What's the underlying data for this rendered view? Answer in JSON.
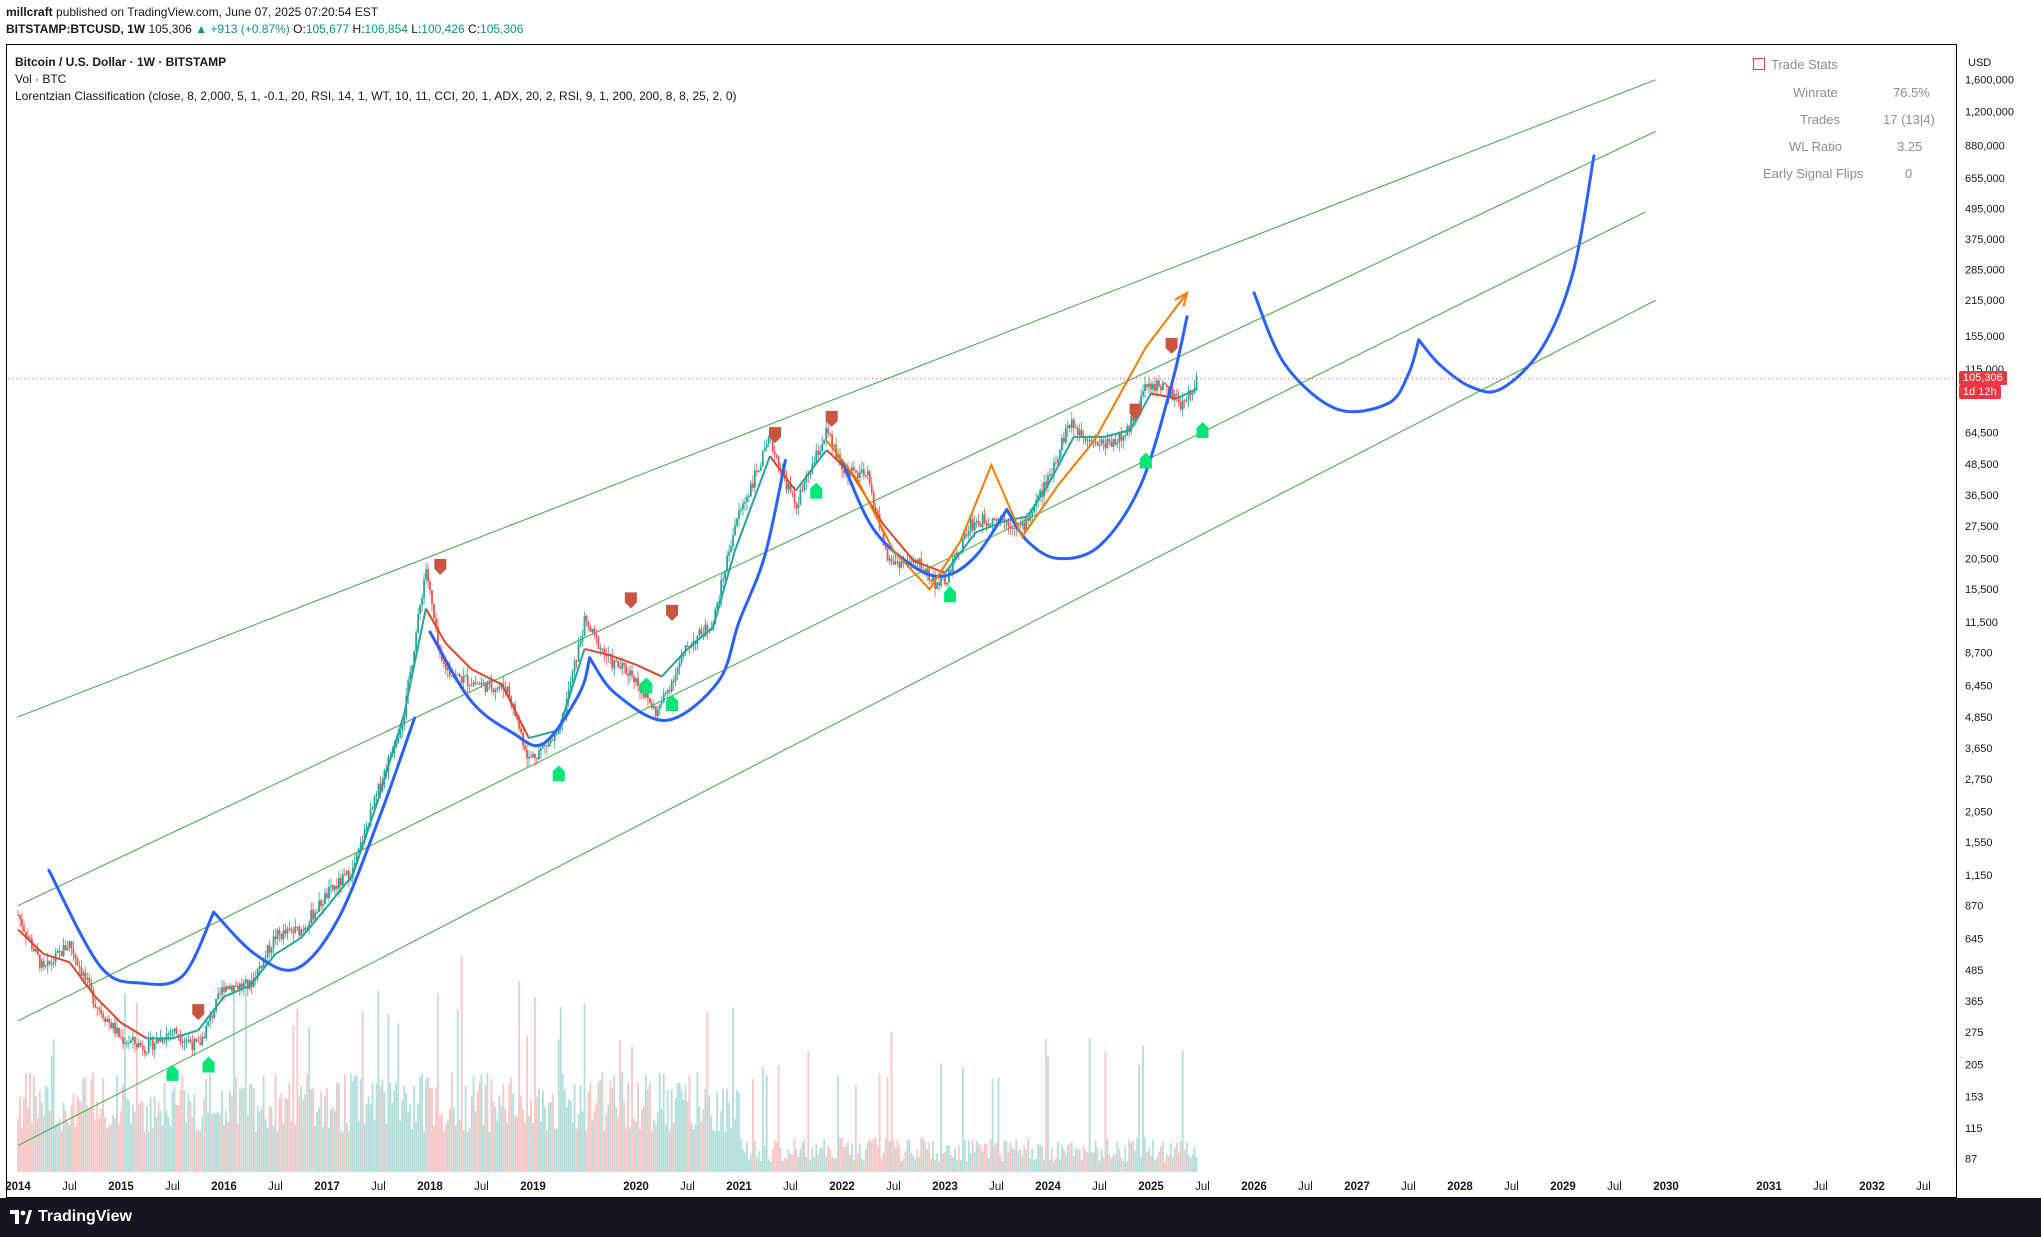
{
  "header": {
    "author": "millcraft",
    "published": "published on TradingView.com, June 07, 2025 07:20:54 EST",
    "symbol": "BITSTAMP:BTCUSD, 1W",
    "last": "105,306",
    "change": "▲ +913 (+0.87%)",
    "o_label": "O:",
    "o_val": "105,677",
    "h_label": "H:",
    "h_val": "106,854",
    "l_label": "L:",
    "l_val": "100,426",
    "c_label": "C:",
    "c_val": "105,306"
  },
  "legend": {
    "title": "Bitcoin / U.S. Dollar · 1W · BITSTAMP",
    "vol": "Vol · BTC",
    "indicator": "Lorentzian Classification (close, 8, 2,000, 5, 1, -0.1, 20, RSI, 14, 1, WT, 10, 11, CCI, 20, 1, ADX, 20, 2, RSI, 9, 1, 200, 200, 8, 8, 25, 2, 0)"
  },
  "trade_stats": {
    "header": "Trade Stats",
    "rows": [
      {
        "label": "Winrate",
        "value": "76.5%"
      },
      {
        "label": "Trades",
        "value": "17 (13|4)"
      },
      {
        "label": "WL Ratio",
        "value": "3.25"
      },
      {
        "label": "Early Signal Flips",
        "value": "0"
      }
    ]
  },
  "price_tag": {
    "price": "105,306",
    "countdown": "1d 12h"
  },
  "footer": {
    "brand": "TradingView"
  },
  "colors": {
    "channel": "#4caf50",
    "projection": "#2962ff",
    "arrow": "#f57c00",
    "kernel_up": "#26a69a",
    "kernel_down": "#d84a2e",
    "buy": "#00e676",
    "sell": "#c8553d",
    "candle_up": "#26a69a",
    "candle_down": "#ef5350",
    "last_price": "#f23645"
  },
  "chart_data": {
    "type": "line",
    "title": "Bitcoin / U.S. Dollar · 1W · BITSTAMP",
    "scale": "log",
    "currency": "USD",
    "y_ticks": [
      "1,600,000",
      "1,200,000",
      "880,000",
      "655,000",
      "495,000",
      "375,000",
      "285,000",
      "215,000",
      "155,000",
      "115,000",
      "64,500",
      "48,500",
      "36,500",
      "27,500",
      "20,500",
      "15,500",
      "11,500",
      "8,700",
      "6,450",
      "4,850",
      "3,650",
      "2,750",
      "2,050",
      "1,550",
      "1,150",
      "870",
      "645",
      "485",
      "365",
      "275",
      "205",
      "153",
      "115",
      "87"
    ],
    "y_tick_values": [
      1600000,
      1200000,
      880000,
      655000,
      495000,
      375000,
      285000,
      215000,
      155000,
      115000,
      64500,
      48500,
      36500,
      27500,
      20500,
      15500,
      11500,
      8700,
      6450,
      4850,
      3650,
      2750,
      2050,
      1550,
      1150,
      870,
      645,
      485,
      365,
      275,
      205,
      153,
      115,
      87
    ],
    "x_ticks": [
      "2014",
      "Jul",
      "2015",
      "Jul",
      "2016",
      "Jul",
      "2017",
      "Jul",
      "2018",
      "Jul",
      "2019",
      "2020",
      "Jul",
      "2021",
      "Jul",
      "2022",
      "Jul",
      "2023",
      "Jul",
      "2024",
      "Jul",
      "2025",
      "Jul",
      "2026",
      "Jul",
      "2027",
      "Jul",
      "2028",
      "Jul",
      "2029",
      "Jul",
      "2030",
      "2031",
      "Jul",
      "2032",
      "Jul"
    ],
    "x_tick_values": [
      2014.0,
      2014.5,
      2015.0,
      2015.5,
      2016.0,
      2016.5,
      2017.0,
      2017.5,
      2018.0,
      2018.5,
      2019.0,
      2020.0,
      2020.5,
      2021.0,
      2021.5,
      2022.0,
      2022.5,
      2023.0,
      2023.5,
      2024.0,
      2024.5,
      2025.0,
      2025.5,
      2026.0,
      2026.5,
      2027.0,
      2027.5,
      2028.0,
      2028.5,
      2029.0,
      2029.5,
      2030.0,
      2031.0,
      2031.5,
      2032.0,
      2032.5
    ],
    "series": [
      {
        "name": "BTCUSD",
        "values": [
          [
            2014.0,
            800
          ],
          [
            2014.25,
            480
          ],
          [
            2014.5,
            620
          ],
          [
            2014.75,
            360
          ],
          [
            2015.0,
            260
          ],
          [
            2015.25,
            240
          ],
          [
            2015.5,
            280
          ],
          [
            2015.75,
            240
          ],
          [
            2016.0,
            420
          ],
          [
            2016.25,
            420
          ],
          [
            2016.5,
            660
          ],
          [
            2016.75,
            700
          ],
          [
            2017.0,
            960
          ],
          [
            2017.25,
            1200
          ],
          [
            2017.5,
            2500
          ],
          [
            2017.75,
            5000
          ],
          [
            2017.96,
            19000
          ],
          [
            2018.1,
            8000
          ],
          [
            2018.25,
            7000
          ],
          [
            2018.5,
            6500
          ],
          [
            2018.75,
            6300
          ],
          [
            2018.96,
            3300
          ],
          [
            2019.25,
            4100
          ],
          [
            2019.5,
            11500
          ],
          [
            2019.75,
            8000
          ],
          [
            2019.96,
            7200
          ],
          [
            2020.2,
            5000
          ],
          [
            2020.5,
            9200
          ],
          [
            2020.75,
            11500
          ],
          [
            2020.96,
            28000
          ],
          [
            2021.3,
            60000
          ],
          [
            2021.55,
            33000
          ],
          [
            2021.85,
            65000
          ],
          [
            2022.0,
            46000
          ],
          [
            2022.25,
            43000
          ],
          [
            2022.45,
            20000
          ],
          [
            2022.75,
            19500
          ],
          [
            2022.9,
            16500
          ],
          [
            2023.0,
            16500
          ],
          [
            2023.25,
            28000
          ],
          [
            2023.5,
            30000
          ],
          [
            2023.75,
            27000
          ],
          [
            2024.0,
            42000
          ],
          [
            2024.2,
            70000
          ],
          [
            2024.5,
            58000
          ],
          [
            2024.75,
            62000
          ],
          [
            2024.95,
            98000
          ],
          [
            2025.1,
            100000
          ],
          [
            2025.3,
            82000
          ],
          [
            2025.45,
            105306
          ]
        ]
      },
      {
        "name": "Kernel estimate",
        "values": [
          [
            2014.0,
            700
          ],
          [
            2014.25,
            560
          ],
          [
            2014.5,
            520
          ],
          [
            2014.75,
            380
          ],
          [
            2015.0,
            300
          ],
          [
            2015.25,
            260
          ],
          [
            2015.5,
            260
          ],
          [
            2015.75,
            280
          ],
          [
            2016.0,
            380
          ],
          [
            2016.25,
            420
          ],
          [
            2016.5,
            560
          ],
          [
            2016.75,
            650
          ],
          [
            2017.0,
            860
          ],
          [
            2017.25,
            1150
          ],
          [
            2017.5,
            2300
          ],
          [
            2017.75,
            5000
          ],
          [
            2017.96,
            13000
          ],
          [
            2018.15,
            9500
          ],
          [
            2018.4,
            7500
          ],
          [
            2018.7,
            6500
          ],
          [
            2018.96,
            4000
          ],
          [
            2019.25,
            4300
          ],
          [
            2019.5,
            9000
          ],
          [
            2019.75,
            8500
          ],
          [
            2020.0,
            7800
          ],
          [
            2020.25,
            7000
          ],
          [
            2020.5,
            9000
          ],
          [
            2020.75,
            11000
          ],
          [
            2020.96,
            22000
          ],
          [
            2021.3,
            52000
          ],
          [
            2021.55,
            38000
          ],
          [
            2021.85,
            55000
          ],
          [
            2022.1,
            44000
          ],
          [
            2022.4,
            28000
          ],
          [
            2022.7,
            20000
          ],
          [
            2023.0,
            18000
          ],
          [
            2023.3,
            26000
          ],
          [
            2023.6,
            29000
          ],
          [
            2023.8,
            30000
          ],
          [
            2024.0,
            40000
          ],
          [
            2024.25,
            62000
          ],
          [
            2024.55,
            62000
          ],
          [
            2024.8,
            66000
          ],
          [
            2025.0,
            92000
          ],
          [
            2025.25,
            88000
          ],
          [
            2025.45,
            96000
          ]
        ]
      }
    ],
    "channel_lines": [
      {
        "from": [
          2014.0,
          4850
        ],
        "to": [
          2029.9,
          1600000
        ]
      },
      {
        "from": [
          2014.0,
          870
        ],
        "to": [
          2029.9,
          1000000
        ]
      },
      {
        "from": [
          2014.0,
          305
        ],
        "to": [
          2029.8,
          480000
        ]
      },
      {
        "from": [
          2014.0,
          98
        ],
        "to": [
          2029.9,
          215000
        ]
      }
    ],
    "projection_curves": [
      [
        [
          2014.3,
          1200
        ],
        [
          2014.8,
          500
        ],
        [
          2015.2,
          430
        ],
        [
          2015.6,
          460
        ],
        [
          2015.9,
          820
        ]
      ],
      [
        [
          2015.9,
          820
        ],
        [
          2016.3,
          560
        ],
        [
          2016.7,
          490
        ],
        [
          2017.1,
          760
        ],
        [
          2017.5,
          1900
        ],
        [
          2017.85,
          4800
        ]
      ],
      [
        [
          2018.0,
          10500
        ],
        [
          2018.4,
          5600
        ],
        [
          2018.8,
          4200
        ],
        [
          2019.1,
          3800
        ],
        [
          2019.45,
          6000
        ],
        [
          2019.55,
          8300
        ]
      ],
      [
        [
          2019.55,
          8300
        ],
        [
          2019.8,
          6000
        ],
        [
          2020.3,
          4700
        ],
        [
          2020.8,
          6700
        ],
        [
          2021.0,
          11500
        ],
        [
          2021.25,
          21000
        ],
        [
          2021.45,
          50000
        ]
      ],
      [
        [
          2022.0,
          50000
        ],
        [
          2022.3,
          27000
        ],
        [
          2022.7,
          19000
        ],
        [
          2023.0,
          17500
        ],
        [
          2023.3,
          21000
        ],
        [
          2023.6,
          32000
        ]
      ],
      [
        [
          2023.6,
          32000
        ],
        [
          2023.8,
          24000
        ],
        [
          2024.1,
          20500
        ],
        [
          2024.5,
          23000
        ],
        [
          2024.9,
          40000
        ],
        [
          2025.2,
          100000
        ],
        [
          2025.35,
          185000
        ]
      ],
      [
        [
          2026.0,
          230000
        ],
        [
          2026.3,
          120000
        ],
        [
          2026.8,
          80000
        ],
        [
          2027.3,
          84000
        ],
        [
          2027.5,
          110000
        ],
        [
          2027.6,
          150000
        ]
      ],
      [
        [
          2027.6,
          150000
        ],
        [
          2027.8,
          120000
        ],
        [
          2028.1,
          98000
        ],
        [
          2028.4,
          96000
        ],
        [
          2028.8,
          140000
        ],
        [
          2029.1,
          280000
        ],
        [
          2029.3,
          800000
        ]
      ]
    ],
    "arrows": [
      [
        [
          2021.85,
          60000
        ],
        [
          2022.15,
          42000
        ],
        [
          2022.5,
          22000
        ],
        [
          2022.85,
          15500
        ],
        [
          2023.15,
          24000
        ],
        [
          2023.45,
          48000
        ],
        [
          2023.75,
          25000
        ],
        [
          2024.1,
          40000
        ],
        [
          2024.45,
          60000
        ],
        [
          2024.95,
          140000
        ],
        [
          2025.35,
          230000
        ]
      ]
    ],
    "buy_signals": [
      [
        2015.5,
        190
      ],
      [
        2015.85,
        205
      ],
      [
        2019.25,
        2900
      ],
      [
        2020.1,
        6450
      ],
      [
        2020.35,
        5500
      ],
      [
        2021.75,
        38000
      ],
      [
        2023.05,
        14800
      ],
      [
        2024.95,
        50000
      ],
      [
        2025.5,
        66000
      ]
    ],
    "sell_signals": [
      [
        2015.75,
        330
      ],
      [
        2018.1,
        19000
      ],
      [
        2019.95,
        14000
      ],
      [
        2020.35,
        12500
      ],
      [
        2021.35,
        63000
      ],
      [
        2021.9,
        73000
      ],
      [
        2024.85,
        78000
      ],
      [
        2025.2,
        142000
      ]
    ]
  }
}
